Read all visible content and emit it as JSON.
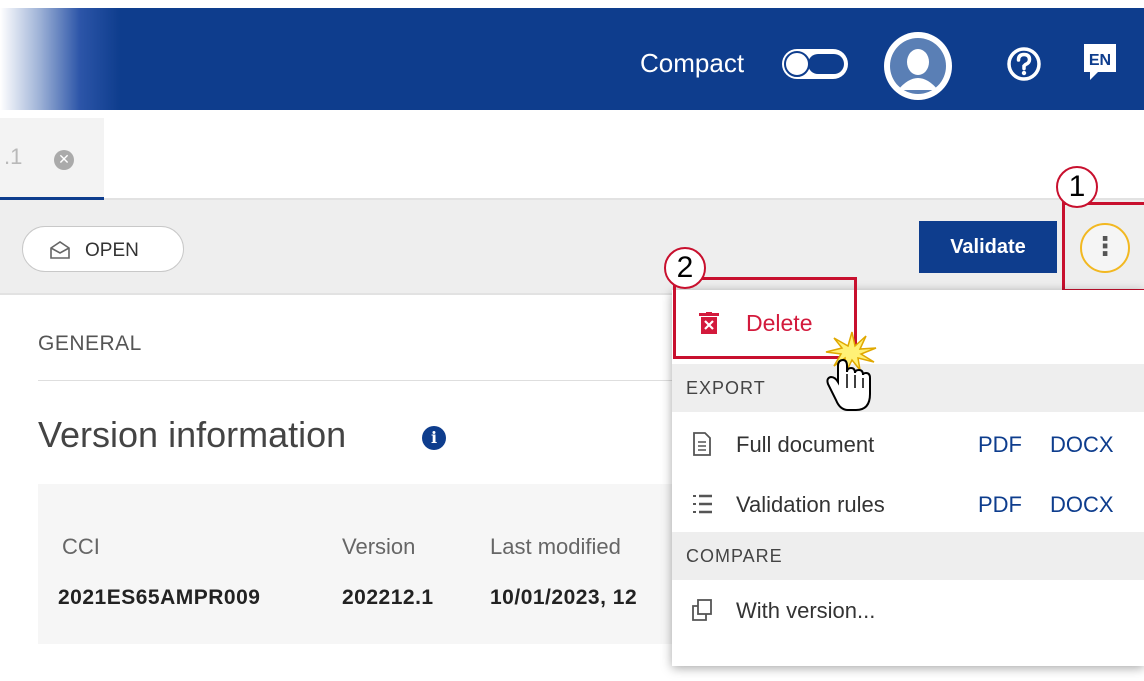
{
  "header": {
    "compact_label": "Compact",
    "lang_code": "EN",
    "colors": {
      "primary": "#0e3d8d",
      "danger": "#d31a3c",
      "callout": "#c8102e",
      "highlight": "#f2b821"
    }
  },
  "tab": {
    "label": ".1",
    "close_icon": "close-circle-icon"
  },
  "toolbar": {
    "status": "OPEN",
    "validate_label": "Validate",
    "more_icon": "kebab-menu-icon"
  },
  "callouts": {
    "one": "1",
    "two": "2"
  },
  "main": {
    "section_label": "GENERAL",
    "title": "Version information",
    "info_icon": "i",
    "columns": [
      {
        "header": "CCI",
        "value": "2021ES65AMPR009"
      },
      {
        "header": "Version",
        "value": "202212.1"
      },
      {
        "header": "Last modified",
        "value": "10/01/2023, 12"
      }
    ]
  },
  "menu": {
    "delete_label": "Delete",
    "export_heading": "EXPORT",
    "export_items": [
      {
        "label": "Full document",
        "pdf": "PDF",
        "docx": "DOCX",
        "icon": "document-icon"
      },
      {
        "label": "Validation rules",
        "pdf": "PDF",
        "docx": "DOCX",
        "icon": "list-icon"
      }
    ],
    "compare_heading": "COMPARE",
    "compare_item": {
      "label": "With version...",
      "icon": "copy-icon"
    }
  }
}
